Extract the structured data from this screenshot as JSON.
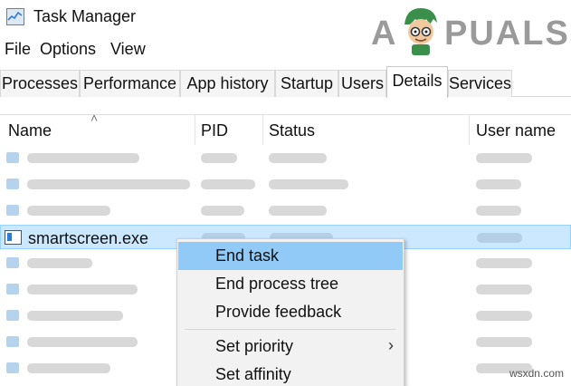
{
  "window": {
    "title": "Task Manager"
  },
  "menubar": {
    "file": "File",
    "options": "Options",
    "view": "View"
  },
  "logo": {
    "left": "A",
    "right": "PUALS"
  },
  "tabs": [
    {
      "label": "Processes"
    },
    {
      "label": "Performance"
    },
    {
      "label": "App history"
    },
    {
      "label": "Startup"
    },
    {
      "label": "Users"
    },
    {
      "label": "Details",
      "active": true
    },
    {
      "label": "Services"
    }
  ],
  "columns": {
    "name": "Name",
    "pid": "PID",
    "status": "Status",
    "user": "User name"
  },
  "selected_process": {
    "name": "smartscreen.exe"
  },
  "context_menu": {
    "end_task": "End task",
    "end_process_tree": "End process tree",
    "provide_feedback": "Provide feedback",
    "set_priority": "Set priority",
    "set_affinity": "Set affinity"
  },
  "watermark": "wsxdn.com",
  "colors": {
    "selection": "#cce8ff",
    "menu_highlight": "#91c9f7",
    "logo_gray": "#9a9a9a"
  }
}
